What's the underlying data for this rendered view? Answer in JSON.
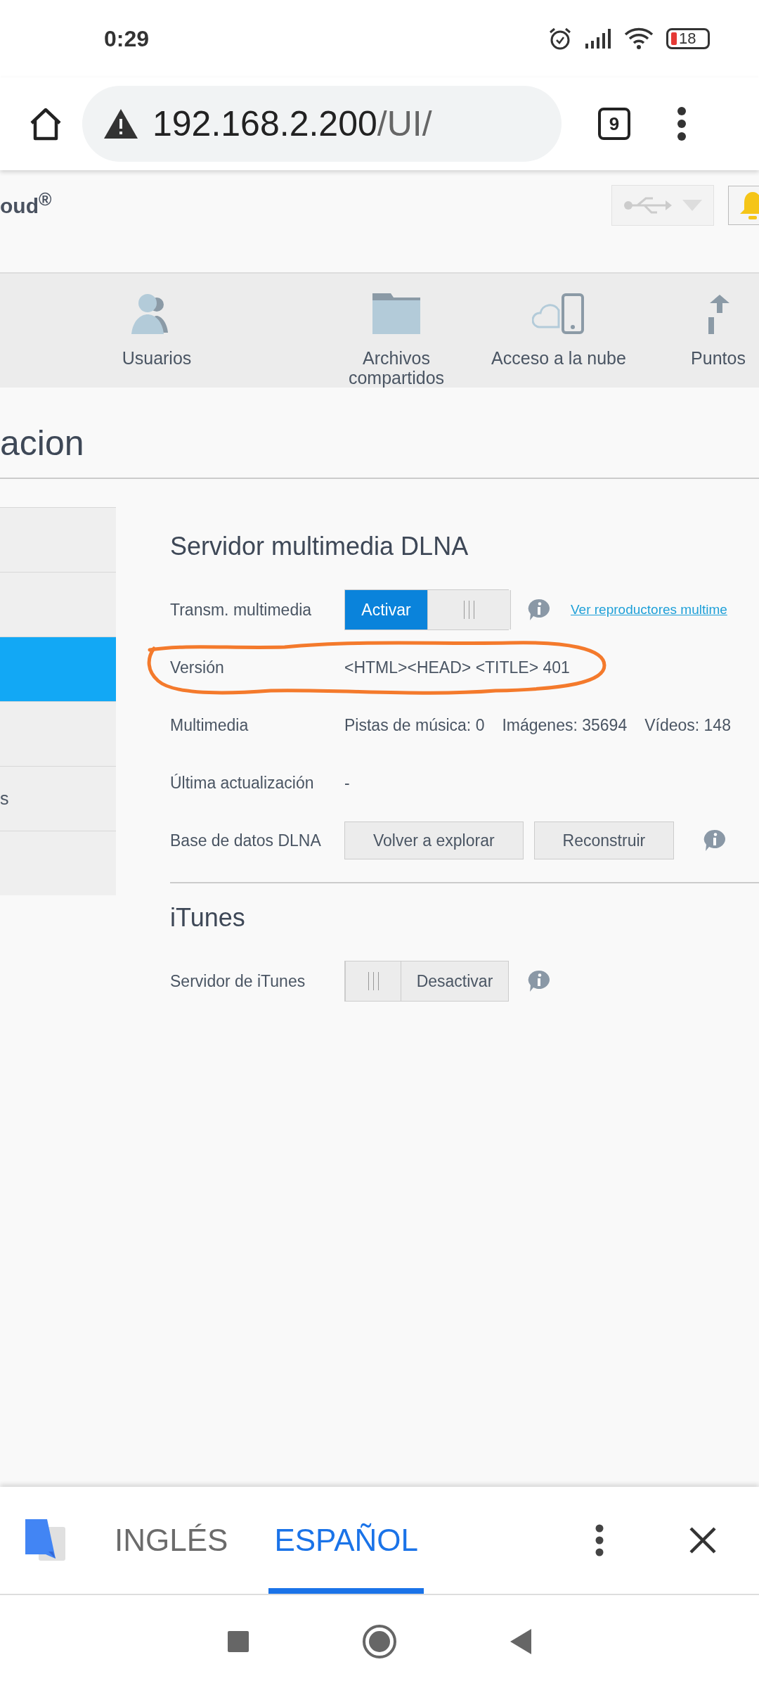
{
  "status_bar": {
    "time": "0:29",
    "battery": "18"
  },
  "browser": {
    "url_host": "192.168.2.200",
    "url_path": "/UI/",
    "tab_count": "9"
  },
  "header": {
    "brand": "oud$^{®}$"
  },
  "nav": [
    {
      "label": "Usuarios"
    },
    {
      "label": "Archivos compartidos"
    },
    {
      "label": "Acceso a la nube"
    },
    {
      "label": "Puntos"
    }
  ],
  "page_title": "acion",
  "sidebar": {
    "items": [
      {
        "selected": false
      },
      {
        "selected": false
      },
      {
        "selected": true
      },
      {
        "selected": false
      },
      {
        "label": "s",
        "selected": false
      },
      {
        "selected": false
      }
    ]
  },
  "sections": [
    {
      "title": "Servidor multimedia DLNA",
      "rows": [
        {
          "kind": "toggle",
          "label": "Transm. multimedia",
          "toggle": {
            "text": "Activar",
            "on": true
          },
          "info": true,
          "link": "Ver reproductores multime"
        },
        {
          "kind": "text",
          "label": "Versión",
          "value": "<HTML><HEAD> <TITLE> 401",
          "circled": true
        },
        {
          "kind": "stats",
          "label": "Multimedia",
          "values": [
            "Pistas de música: 0",
            "Imágenes: 35694",
            "Vídeos: 148"
          ]
        },
        {
          "kind": "text",
          "label": "Última actualización",
          "value": "-"
        },
        {
          "kind": "buttons",
          "label": "Base de datos DLNA",
          "buttons": [
            "Volver a explorar",
            "Reconstruir"
          ],
          "info": true
        }
      ]
    },
    {
      "title": "iTunes",
      "rows": [
        {
          "kind": "toggle",
          "label": "Servidor de iTunes",
          "toggle": {
            "text": "Desactivar",
            "on": false
          },
          "info": true
        }
      ]
    }
  ],
  "translate_bar": {
    "tabs": [
      {
        "label": "INGLÉS",
        "selected": false
      },
      {
        "label": "ESPAÑOL",
        "selected": true
      }
    ]
  }
}
